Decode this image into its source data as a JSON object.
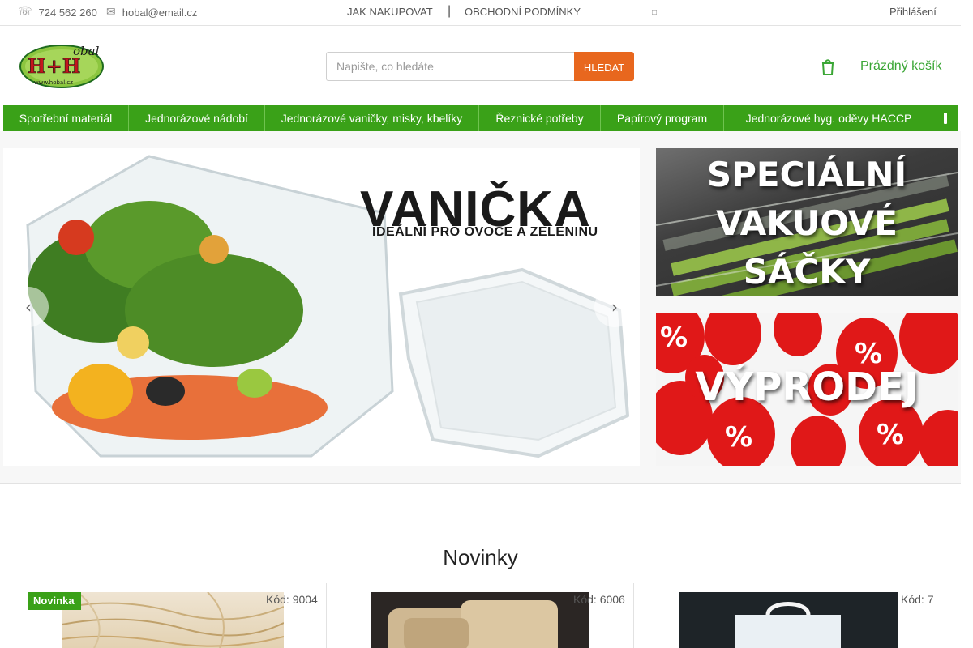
{
  "topbar": {
    "phone": "724 562 260",
    "email": "hobal@email.cz",
    "nav": [
      "JAK NAKUPOVAT",
      "OBCHODNÍ PODMÍNKY"
    ],
    "separator": "|",
    "login": "Přihlášení",
    "icons": {
      "phone": "phone-icon",
      "email": "envelope-icon",
      "dropdown": "dropdown-icon"
    }
  },
  "logo": {
    "letters": "H+H",
    "script": "obal",
    "url_text": "www.hobal.cz"
  },
  "search": {
    "placeholder": "Napište, co hledáte",
    "value": "",
    "button": "HLEDAT"
  },
  "cart": {
    "label": "Prázdný košík",
    "icon": "cart-icon"
  },
  "menu": {
    "items": [
      "Spotřební materiál",
      "Jednorázové nádobí",
      "Jednorázové vaničky, misky, kbelíky",
      "Řeznické potřeby",
      "Papírový program",
      "Jednorázové hyg. oděvy HACCP"
    ],
    "more_icon": "more-icon"
  },
  "hero": {
    "title": "VANIČKA",
    "subtitle": "IDEÁLNÍ PRO OVOCE A ZELENINU",
    "prev_icon": "chevron-left-icon",
    "next_icon": "chevron-right-icon"
  },
  "banners": {
    "vakuove": [
      "SPECIÁLNÍ",
      "VAKUOVÉ",
      "SÁČKY"
    ],
    "vyprodej": "VÝPRODEJ",
    "percent_glyph": "%"
  },
  "novinky": {
    "title": "Novinky",
    "products": [
      {
        "badge": "Novinka",
        "code": "Kód: 9004"
      },
      {
        "badge": "",
        "code": "Kód: 6006"
      },
      {
        "badge": "",
        "code": "Kód: 7"
      }
    ]
  },
  "colors": {
    "green": "#3aa118",
    "orange": "#e8671e",
    "cart_green": "#3aa635"
  }
}
